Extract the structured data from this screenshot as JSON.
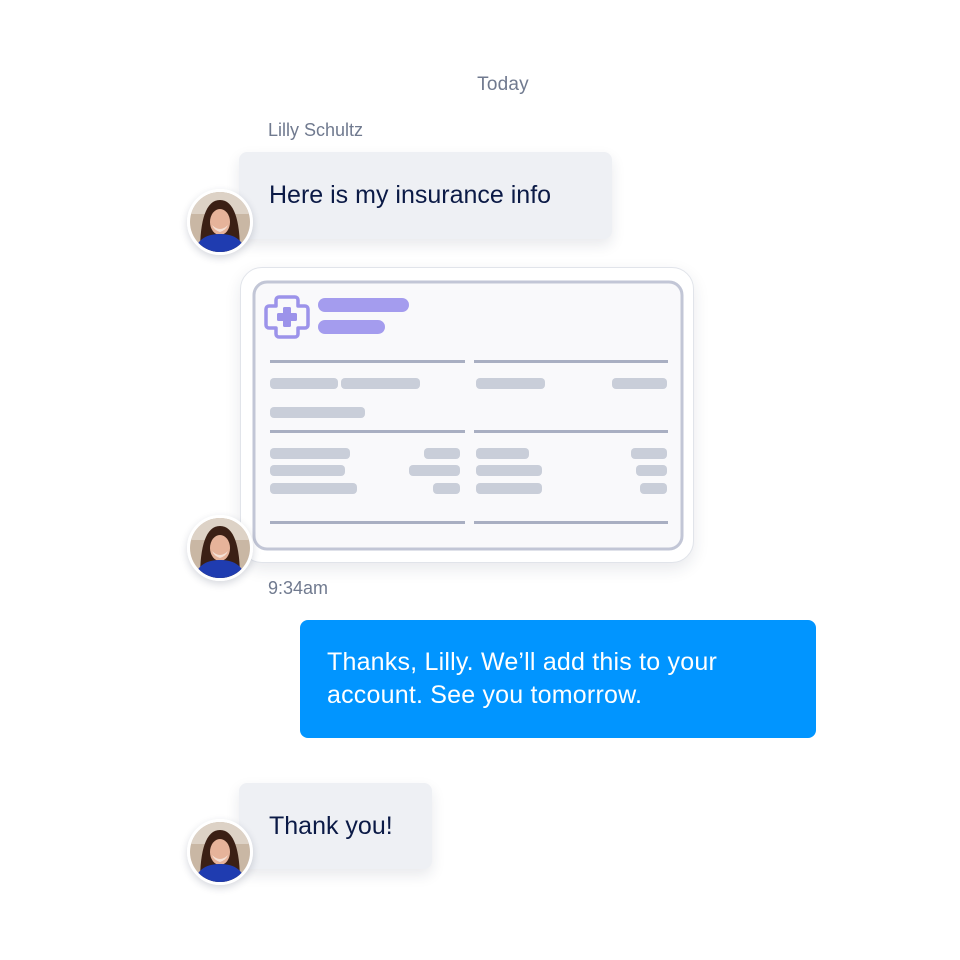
{
  "conversation": {
    "date_label": "Today",
    "sender_name": "Lilly Schultz",
    "messages": [
      {
        "from": "Lilly Schultz",
        "text": "Here is my insurance info"
      },
      {
        "from": "Lilly Schultz",
        "attachment": "insurance-card-image",
        "timestamp": "9:34am"
      },
      {
        "from": "me",
        "text": "Thanks, Lilly. We’ll add this to your account. See you tomorrow."
      },
      {
        "from": "Lilly Schultz",
        "text": "Thank you!"
      }
    ]
  },
  "icons": {
    "medical_cross": "medical-cross-icon",
    "avatar": "avatar"
  },
  "colors": {
    "outgoing_bubble": "#0195ff",
    "incoming_bubble": "#eef0f4",
    "incoming_text": "#0b1a46",
    "muted_text": "#707a8f",
    "card_accent": "#a49cee",
    "card_placeholder": "#c9ced9",
    "card_border": "#c2c6d6"
  }
}
